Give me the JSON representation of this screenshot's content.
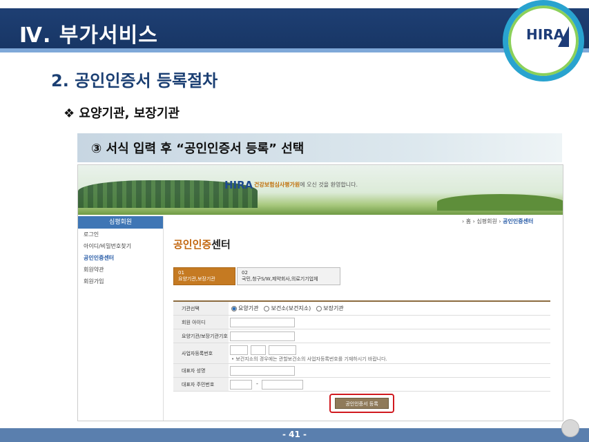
{
  "slide": {
    "title": "Ⅳ. 부가서비스",
    "logo": "HIRA",
    "section": "2. 공인인증서 등록절차",
    "subsection": "❖ 요양기관, 보장기관",
    "step": "③ 서식 입력 후 “공인인증서 등록” 선택",
    "page_number": "- 41 -"
  },
  "site": {
    "logo": "HIRA",
    "welcome_highlight": "건강보험심사평가원",
    "welcome_rest": "에 오신 것을 환영합니다.",
    "sidebar": {
      "header": "심평회원",
      "items": [
        "로그인",
        "아이디/비밀번호찾기",
        "공인인증센터",
        "회원약관",
        "회원가입"
      ]
    },
    "breadcrumb": {
      "home": "› 홈",
      "sep1": "›",
      "parent": "심평회원",
      "sep2": "›",
      "current": "공인인증센터"
    },
    "page_heading_accent": "공인인증",
    "page_heading_rest": "센터",
    "tabs": [
      {
        "num": "01",
        "label": "요양기관,보장기관"
      },
      {
        "num": "02",
        "label": "국민,청구S/W,제약회사,의료기기업체"
      }
    ],
    "form": {
      "org_type_label": "기관선택",
      "org_options": [
        "요양기관",
        "보건소(보건지소)",
        "보장기관"
      ],
      "member_id_label": "회원 아이디",
      "org_code_label": "요양기관/보장기관기호",
      "bizno_label": "사업자등록번호",
      "bizno_note": "• 보건지소의 경우에는 관할보건소의 사업자등록번호를 기재하시기 바랍니다.",
      "rep_name_label": "대표자 성명",
      "rep_rrn_label": "대표자 주민번호",
      "rrn_dash": "-"
    },
    "submit_label": "공인인증서 등록"
  }
}
